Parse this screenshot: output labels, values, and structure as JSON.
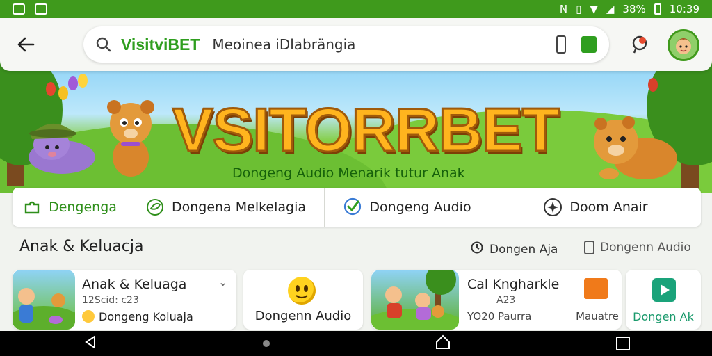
{
  "status_bar": {
    "battery": "38%",
    "time": "10:39"
  },
  "search": {
    "brand": "VisitviBET",
    "query": "Meoinea iDlabrängia"
  },
  "banner": {
    "title": "VSITORRBET",
    "subtitle": "Dongeng Audio Menarik tutur Anak"
  },
  "categories": [
    {
      "label": "Dengenga",
      "icon": "puzzle-icon"
    },
    {
      "label": "Dongena Melkelagia",
      "icon": "leaf-icon"
    },
    {
      "label": "Dongeng Audio",
      "icon": "chat-check-icon"
    },
    {
      "label": "Doom Anair",
      "icon": "spark-icon"
    }
  ],
  "section": {
    "title": "Anak & Keluacja",
    "filters": [
      "Dongen Aja",
      "Dongenn Audio"
    ]
  },
  "cards": [
    {
      "title": "Anak & Keluaga",
      "meta": "12Scid: c23",
      "tag": "Dongeng Koluaja"
    },
    {
      "label": "Dongenn Audio"
    },
    {
      "title": "Cal Kngharkle",
      "meta": "A23",
      "sub": "YO20 Paurra"
    },
    {
      "label": "Mauatre"
    },
    {
      "label": "Dongen Ak"
    }
  ],
  "colors": {
    "accent": "#3f9a1c",
    "brand_text": "#2f9e1f",
    "banner_title": "#ffb41e"
  }
}
